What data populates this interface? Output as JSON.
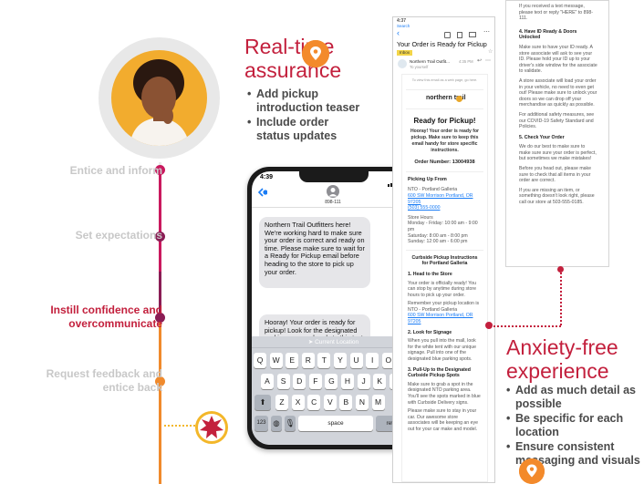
{
  "timeline": {
    "steps": [
      {
        "label": "Entice and inform"
      },
      {
        "label": "Set expectations"
      },
      {
        "label": "Instill confidence and overcommunicate"
      },
      {
        "label": "Request feedback and entice back"
      }
    ],
    "colors": {
      "muted": "#c8c8c8",
      "active": "#c3203d",
      "line_top": "#c9195e",
      "line_mid": "#8a1d55",
      "line_bottom": "#f08a2c"
    }
  },
  "realtime": {
    "title": "Real-time assurance",
    "bullets": [
      "Add pickup introduction teaser",
      "Include order status updates"
    ]
  },
  "anxiety": {
    "title": "Anxiety-free experience",
    "bullets": [
      "Add as much detail as possible",
      "Be specific for each location",
      "Ensure consistent messaging and visuals"
    ]
  },
  "phone": {
    "time": "4:39",
    "contact": "898-111",
    "message1": "Northern Trail Outfitters here! We're working hard to make sure your order is correct and ready on time. Please make sure to wait for a Ready for Pickup email before heading to the store to pick up your order.",
    "message2": "Hooray! Your order is ready for pickup! Look for the designated parking area and reply to this text with HERE when you arrive.",
    "placeholder": "iMessage",
    "current_location": "Current Location",
    "keys_row1": [
      "Q",
      "W",
      "E",
      "R",
      "T",
      "Y",
      "U",
      "I",
      "O",
      "P"
    ],
    "keys_row2": [
      "A",
      "S",
      "D",
      "F",
      "G",
      "H",
      "J",
      "K",
      "L"
    ],
    "keys_row3": [
      "Z",
      "X",
      "C",
      "V",
      "B",
      "N",
      "M"
    ],
    "key_123": "123",
    "key_space": "space",
    "key_return": "return"
  },
  "email1": {
    "status_time": "4:37",
    "search": "Search",
    "subject": "Your Order is Ready for Pickup",
    "inbox": "Inbox",
    "sender": "Northern Trail Outfit...",
    "sender_time": "4:35 PM",
    "to_me": "To yourself",
    "browser_note": "To view this email as a web page, go here.",
    "logo_text": "northern trail",
    "heading": "Ready for Pickup!",
    "intro": "Hooray! Your order is ready for pickup. Make sure to keep this email handy for store specific instructions.",
    "order_label": "Order Number: 13004938",
    "pickup_from": "Picking Up From",
    "store_name": "NTO - Portland Galleria",
    "store_addr": "600 SW Morrison Portland, OR 97205",
    "store_phone": "(503) 555-0000",
    "hours_title": "Store Hours",
    "hours_1": "Monday - Friday: 10:00 am - 9:00 pm",
    "hours_2": "Saturday: 8:00 am - 8:00 pm",
    "hours_3": "Sunday: 12:00 am - 6:00 pm",
    "inst_title": "Curbside Pickup Instructions for Portland Galleria",
    "step1_title": "1. Head to the Store",
    "step1_text": "Your order is officially ready! You can stop by anytime during store hours to pick up your order.",
    "step1_text2": "Remember your pickup location is NTO - Portland Galleria",
    "step1_addr": "600 SW Morrison Portland, OR 97205",
    "step2_title": "2. Look for Signage",
    "step2_text": "When you pull into the mall, look for the white tent with our unique signage. Pull into one of the designated blue parking spots.",
    "step3_title": "3. Pull-Up to the Designated Curbside Pickup Spots",
    "step3_text": "Make sure to grab a spot in the designated NTO parking area. You'll see the spots marked in blue with Curbside Delivery signs.",
    "step3_text2": "Please make sure to stay in your car. Our awesome store associates will be keeping an eye out for your car make and model."
  },
  "email2": {
    "top_text": "If you received a text message, please text or reply \"HERE\" to 898-111.",
    "step4_title": "4. Have ID Ready & Doors Unlocked",
    "step4_text": "Make sure to have your ID ready. A store associate will ask to see your ID. Please hold your ID up to your driver's side window for the associate to validate.",
    "step4_text2": "A store associate will load your order in your vehicle, no need to even get out! Please make sure to unlock your doors so we can drop off your merchandise as quickly as possible.",
    "step4_text3": "For additional safety measures, see our COVID-19 Safety Standard and Policies.",
    "step5_title": "5. Check Your Order",
    "step5_text": "We do our best to make sure to make sure sure your order is perfect, but sometimes we make mistakes!",
    "step5_text2": "Before you head out, please make sure to check that all items in your order are correct.",
    "step5_text3": "If you are missing an item, or something doesn't look right, please call our store at 503-555-0185."
  }
}
